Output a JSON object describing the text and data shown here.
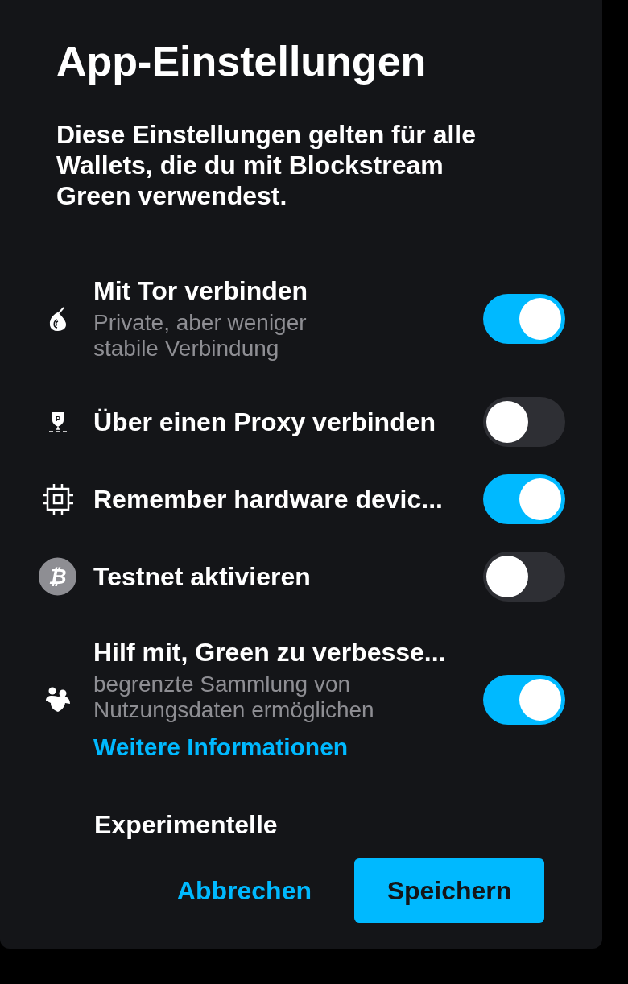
{
  "title": "App-Einstellungen",
  "description": "Diese Einstellungen gelten für alle Wallets, die du mit Blockstream Green verwendest.",
  "settings": [
    {
      "kind": "tor",
      "label": "Mit Tor verbinden",
      "subtitle": "Private, aber weniger stabile Verbindung",
      "on": true
    },
    {
      "kind": "proxy",
      "icon_text": "P",
      "label": "Über einen Proxy verbinden",
      "on": false
    },
    {
      "kind": "chip",
      "label": "Remember hardware devic...",
      "on": true
    },
    {
      "kind": "bitcoin",
      "icon_text": "₿",
      "label": "Testnet aktivieren",
      "on": false
    },
    {
      "kind": "analytics",
      "label": "Hilf mit, Green zu verbesse...",
      "subtitle": "begrenzte Sammlung von Nutzungsdaten ermöglichen",
      "link": "Weitere Informationen",
      "on": true
    }
  ],
  "section_heading": "Experimentelle",
  "buttons": {
    "cancel": "Abbrechen",
    "save": "Speichern"
  }
}
